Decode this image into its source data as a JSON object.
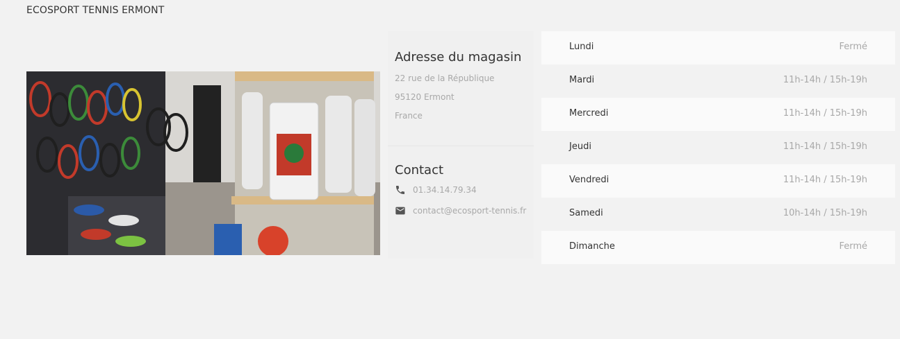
{
  "header": {
    "store_name": "ECOSPORT TENNIS ERMONT"
  },
  "address": {
    "heading": "Adresse du magasin",
    "street": "22 rue de la République",
    "city": "95120 Ermont",
    "country": "France"
  },
  "contact": {
    "heading": "Contact",
    "phone": "01.34.14.79.34",
    "email": "contact@ecosport-tennis.fr",
    "phone_icon": "phone-icon",
    "email_icon": "mail-icon"
  },
  "hours": [
    {
      "day": "Lundi",
      "time": "Fermé"
    },
    {
      "day": "Mardi",
      "time": "11h-14h / 15h-19h"
    },
    {
      "day": "Mercredi",
      "time": "11h-14h / 15h-19h"
    },
    {
      "day": "Jeudi",
      "time": "11h-14h / 15h-19h"
    },
    {
      "day": "Vendredi",
      "time": "11h-14h / 15h-19h"
    },
    {
      "day": "Samedi",
      "time": "10h-14h / 15h-19h"
    },
    {
      "day": "Dimanche",
      "time": "Fermé"
    }
  ],
  "colors": {
    "background": "#f2f2f2",
    "row_light": "#fafafa",
    "text": "#333333",
    "muted": "#a8a8a8"
  }
}
